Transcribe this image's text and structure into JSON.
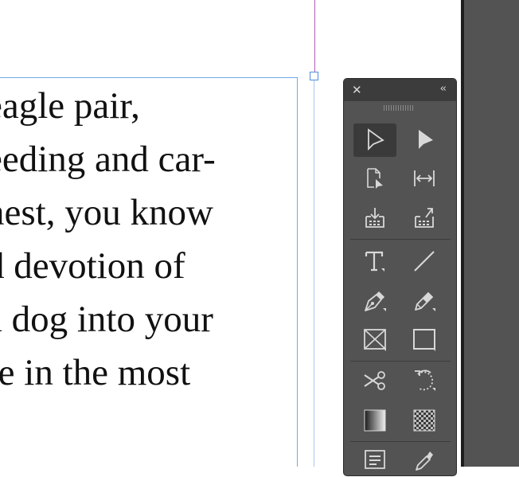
{
  "document": {
    "text_lines": [
      "eagle pair,",
      "eeding and car-",
      "nest, you know",
      "d devotion of",
      "a dog into your",
      "re in the most"
    ]
  },
  "tools_panel": {
    "close_glyph": "✕",
    "collapse_glyph": "‹‹",
    "tools": [
      {
        "name": "selection-tool",
        "icon": "selection-arrow-icon",
        "active": true
      },
      {
        "name": "direct-selection-tool",
        "icon": "direct-selection-arrow-icon",
        "active": false
      },
      {
        "name": "page-tool",
        "icon": "page-tool-icon",
        "active": false
      },
      {
        "name": "gap-tool",
        "icon": "gap-tool-icon",
        "active": false
      },
      {
        "name": "content-collector-tool",
        "icon": "content-collector-icon",
        "active": false
      },
      {
        "name": "content-placer-tool",
        "icon": "content-placer-icon",
        "active": false
      },
      {
        "name": "type-tool",
        "icon": "type-icon",
        "active": false
      },
      {
        "name": "line-tool",
        "icon": "line-icon",
        "active": false
      },
      {
        "name": "pen-tool",
        "icon": "pen-icon",
        "active": false
      },
      {
        "name": "pencil-tool",
        "icon": "pencil-icon",
        "active": false
      },
      {
        "name": "rectangle-frame-tool",
        "icon": "rectangle-frame-icon",
        "active": false
      },
      {
        "name": "rectangle-tool",
        "icon": "rectangle-icon",
        "active": false
      },
      {
        "name": "scissors-tool",
        "icon": "scissors-icon",
        "active": false
      },
      {
        "name": "free-transform-tool",
        "icon": "rotate-icon",
        "active": false
      },
      {
        "name": "gradient-swatch-tool",
        "icon": "gradient-icon",
        "active": false
      },
      {
        "name": "gradient-feather-tool",
        "icon": "gradient-feather-icon",
        "active": false
      },
      {
        "name": "note-tool",
        "icon": "note-icon",
        "active": false
      },
      {
        "name": "eyedropper-tool",
        "icon": "eyedropper-icon",
        "active": false
      }
    ]
  },
  "colors": {
    "panel_bg": "#535353",
    "panel_header": "#3c3c3c",
    "icon": "#d8d8d8",
    "frame_edge": "#6fa8e8",
    "margin_guide": "#b25fb2"
  }
}
